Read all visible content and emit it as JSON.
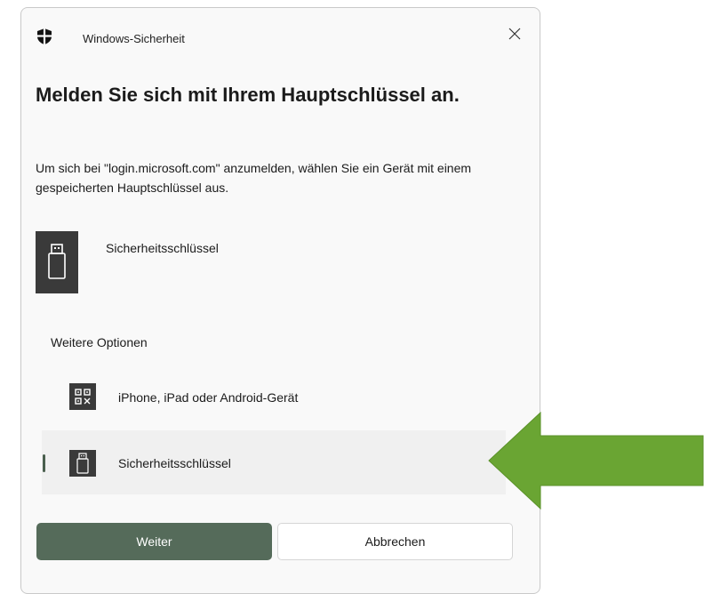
{
  "titlebar": {
    "app_name": "Windows-Sicherheit",
    "icon": "shield-icon",
    "close_icon": "close-icon"
  },
  "dialog": {
    "heading": "Melden Sie sich mit Ihrem Hauptschlüssel an.",
    "description": "Um sich bei \"login.microsoft.com\" anzumelden, wählen Sie ein Gerät mit einem gespeicherten Hauptschlüssel aus.",
    "primary_option": {
      "label": "Sicherheitsschlüssel",
      "icon": "usb-key-icon"
    },
    "more_options_label": "Weitere Optionen",
    "options": [
      {
        "label": "iPhone, iPad oder Android-Gerät",
        "icon": "qr-code-icon",
        "selected": false
      },
      {
        "label": "Sicherheitsschlüssel",
        "icon": "usb-key-icon",
        "selected": true
      }
    ]
  },
  "buttons": {
    "next_label": "Weiter",
    "cancel_label": "Abbrechen"
  },
  "colors": {
    "accent": "#556b5a",
    "arrow": "#6aa533",
    "tile": "#3a3a3a"
  }
}
